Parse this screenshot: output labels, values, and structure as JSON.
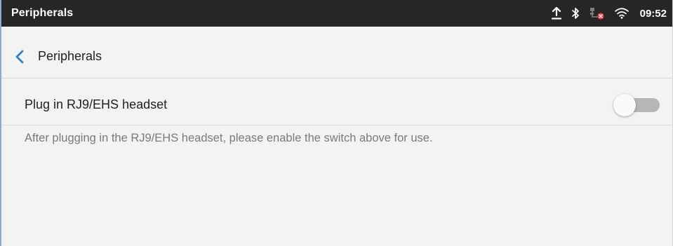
{
  "statusbar": {
    "title": "Peripherals",
    "time": "09:52",
    "icons": [
      "upload-icon",
      "bluetooth-icon",
      "ethernet-error-icon",
      "wifi-icon"
    ]
  },
  "toolbar": {
    "back_icon": "chevron-left-icon",
    "title": "Peripherals"
  },
  "setting": {
    "label": "Plug in RJ9/EHS headset",
    "enabled": false
  },
  "description": "After plugging in the RJ9/EHS headset, please enable the switch above for use.",
  "colors": {
    "statusbar_bg": "#262626",
    "accent": "#2f7fd1",
    "toggle_off_track": "#b6b6b6",
    "background": "#f3f3f3"
  }
}
